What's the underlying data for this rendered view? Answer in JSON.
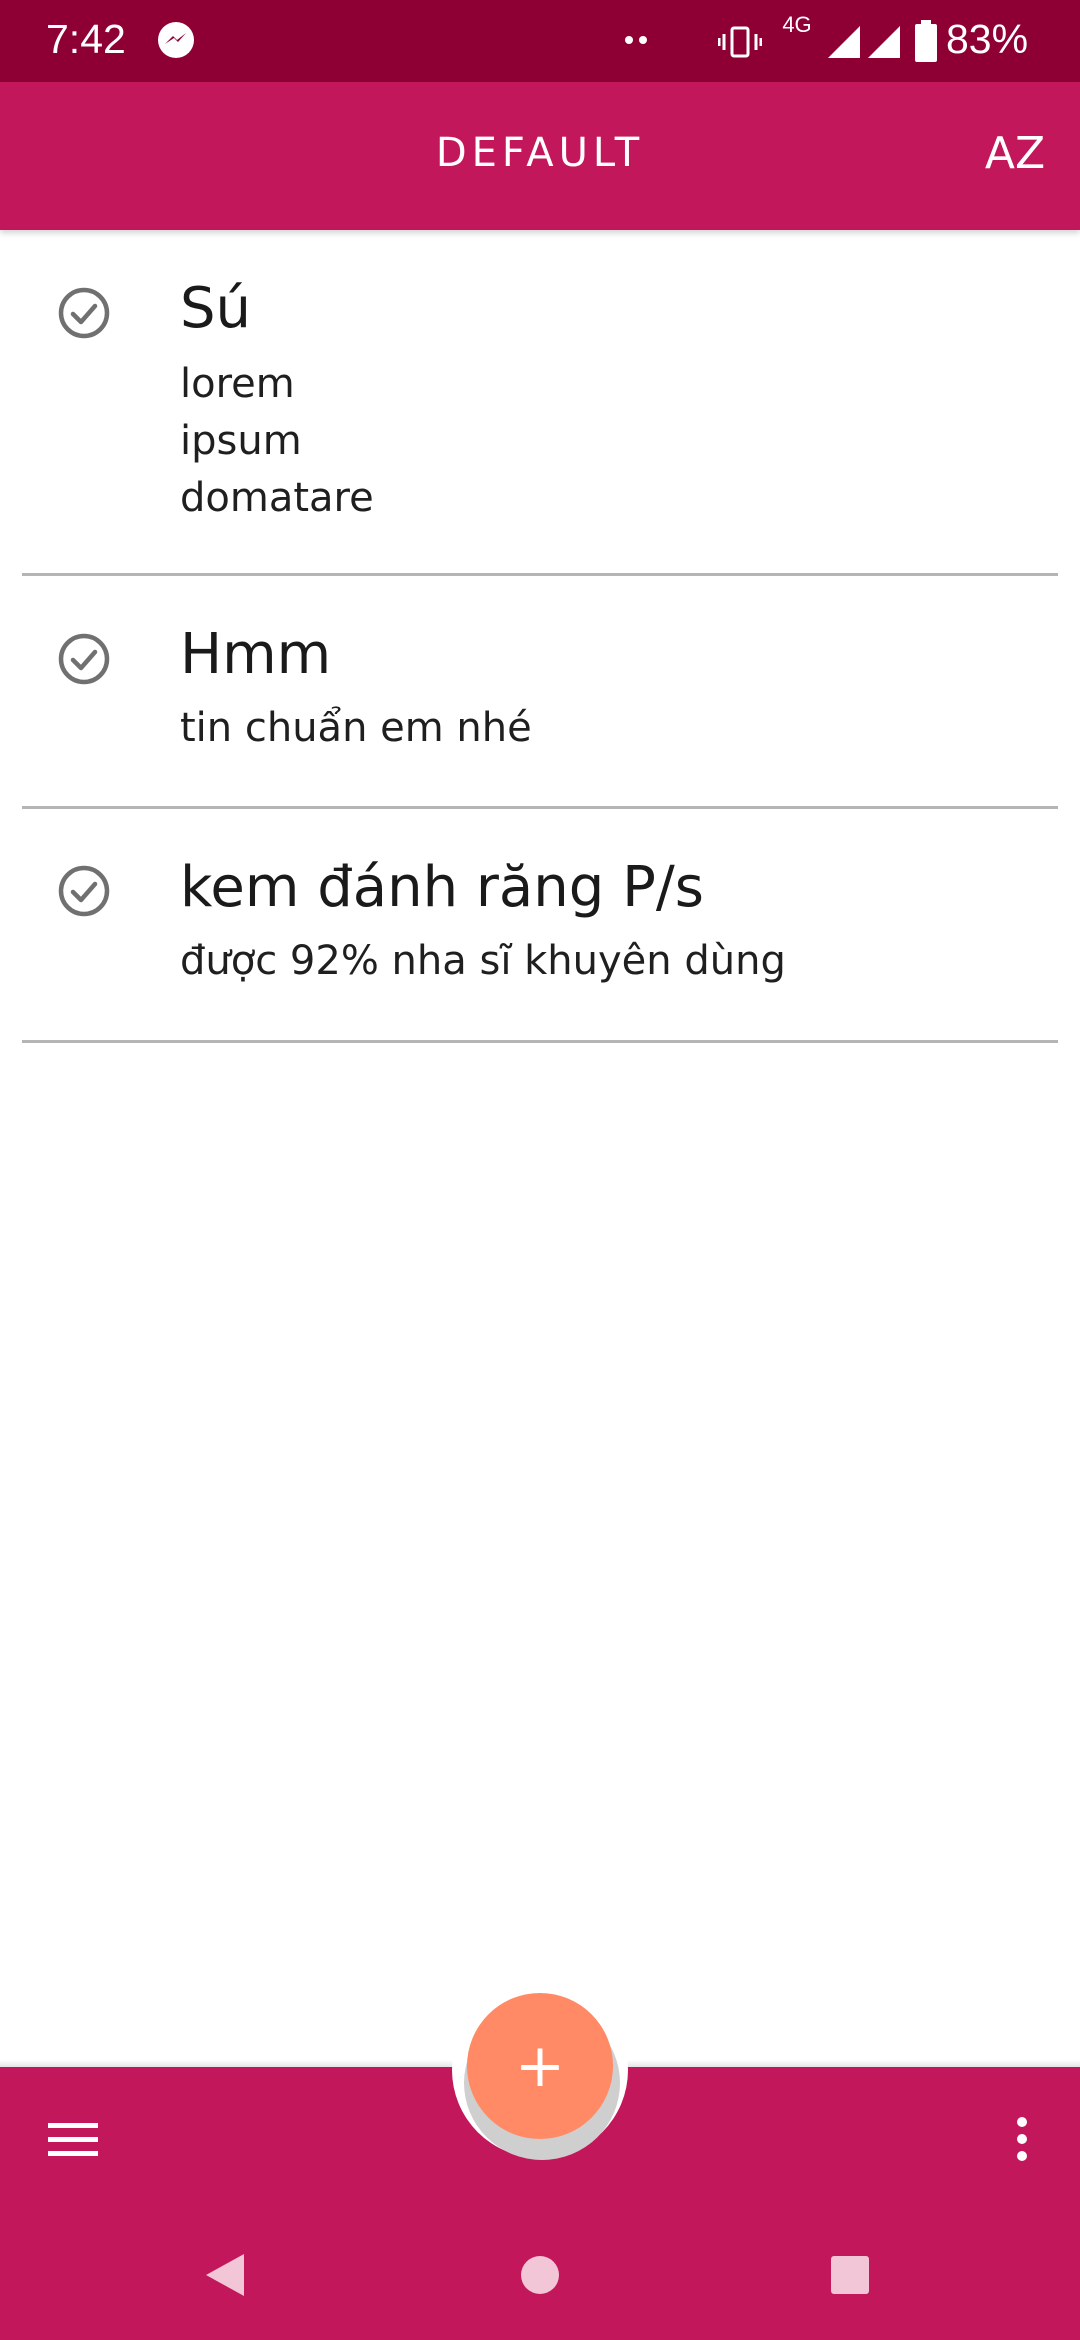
{
  "status_bar": {
    "time": "7:42",
    "network": "4G",
    "battery": "83%",
    "icons": [
      "messenger-icon",
      "dots-icon",
      "vibrate-icon",
      "signal-icon",
      "battery-icon"
    ]
  },
  "app_bar": {
    "title": "DEFAULT",
    "sort_label": "AZ",
    "sort_icon": "sort-az-icon"
  },
  "items": [
    {
      "title": "Sú",
      "lines": [
        "lorem",
        "ipsum",
        "domatare"
      ]
    },
    {
      "title": "Hmm",
      "lines": [
        "tin chuẩn em nhé"
      ]
    },
    {
      "title": "kem đánh răng P/s",
      "lines": [
        "được 92% nha sĩ khuyên dùng"
      ]
    }
  ],
  "fab": {
    "label": "+",
    "icon": "plus-icon"
  },
  "bottom_bar": {
    "left_icon": "menu-icon",
    "right_icon": "more-vert-icon"
  },
  "colors": {
    "status_bar": "#8e0034",
    "primary": "#c2185b",
    "fab": "#ff8a65",
    "check_icon": "#707070",
    "divider": "#b5b5b5"
  }
}
